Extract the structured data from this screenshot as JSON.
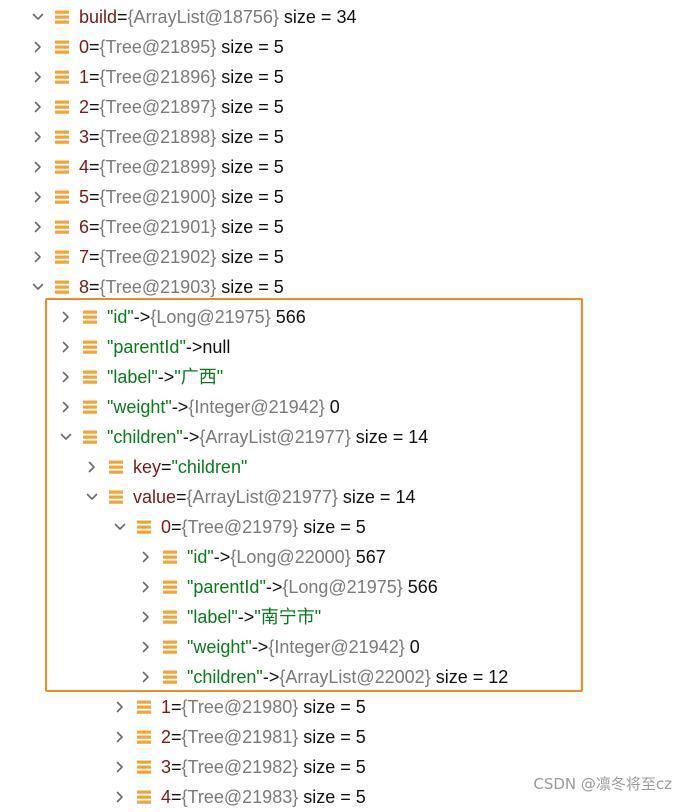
{
  "colors": {
    "icon_orange": "#f0a53b",
    "highlight": "#f08a24",
    "string_green": "#067d17",
    "key_red": "#7a1a1a",
    "ref_gray": "#7a7a7a"
  },
  "rows": [
    {
      "expanded": true,
      "icon": "list-icon",
      "name": "build",
      "op": " = ",
      "ref": "{ArrayList@18756}",
      "tail": " size = 34",
      "key_string": false,
      "value_string": false
    },
    {
      "expanded": false,
      "icon": "list-icon",
      "name": "0",
      "op": " = ",
      "ref": "{Tree@21895}",
      "tail": " size = 5",
      "key_string": false,
      "value_string": false
    },
    {
      "expanded": false,
      "icon": "list-icon",
      "name": "1",
      "op": " = ",
      "ref": "{Tree@21896}",
      "tail": " size = 5",
      "key_string": false,
      "value_string": false
    },
    {
      "expanded": false,
      "icon": "list-icon",
      "name": "2",
      "op": " = ",
      "ref": "{Tree@21897}",
      "tail": " size = 5",
      "key_string": false,
      "value_string": false
    },
    {
      "expanded": false,
      "icon": "list-icon",
      "name": "3",
      "op": " = ",
      "ref": "{Tree@21898}",
      "tail": " size = 5",
      "key_string": false,
      "value_string": false
    },
    {
      "expanded": false,
      "icon": "list-icon",
      "name": "4",
      "op": " = ",
      "ref": "{Tree@21899}",
      "tail": " size = 5",
      "key_string": false,
      "value_string": false
    },
    {
      "expanded": false,
      "icon": "list-icon",
      "name": "5",
      "op": " = ",
      "ref": "{Tree@21900}",
      "tail": " size = 5",
      "key_string": false,
      "value_string": false
    },
    {
      "expanded": false,
      "icon": "list-icon",
      "name": "6",
      "op": " = ",
      "ref": "{Tree@21901}",
      "tail": " size = 5",
      "key_string": false,
      "value_string": false
    },
    {
      "expanded": false,
      "icon": "list-icon",
      "name": "7",
      "op": " = ",
      "ref": "{Tree@21902}",
      "tail": " size = 5",
      "key_string": false,
      "value_string": false
    },
    {
      "expanded": true,
      "icon": "list-icon",
      "name": "8",
      "op": " = ",
      "ref": "{Tree@21903}",
      "tail": " size = 5",
      "key_string": false,
      "value_string": false
    },
    {
      "expanded": false,
      "icon": "list-icon",
      "name": "\"id\"",
      "op": " -> ",
      "ref": "{Long@21975}",
      "tail": " 566",
      "key_string": true,
      "value_string": false
    },
    {
      "expanded": false,
      "icon": "list-icon",
      "name": "\"parentId\"",
      "op": " -> ",
      "ref": "",
      "tail": "null",
      "key_string": true,
      "value_string": false
    },
    {
      "expanded": false,
      "icon": "list-icon",
      "name": "\"label\"",
      "op": " -> ",
      "ref": "",
      "tail": "\"广西\"",
      "key_string": true,
      "value_string": true
    },
    {
      "expanded": false,
      "icon": "list-icon",
      "name": "\"weight\"",
      "op": " -> ",
      "ref": "{Integer@21942}",
      "tail": " 0",
      "key_string": true,
      "value_string": false
    },
    {
      "expanded": true,
      "icon": "list-icon",
      "name": "\"children\"",
      "op": " -> ",
      "ref": "{ArrayList@21977}",
      "tail": " size = 14",
      "key_string": true,
      "value_string": false
    },
    {
      "expanded": false,
      "icon": "list-icon",
      "name": "key",
      "op": " = ",
      "ref": "",
      "tail": "\"children\"",
      "key_string": false,
      "value_string": true
    },
    {
      "expanded": true,
      "icon": "list-icon",
      "name": "value",
      "op": " = ",
      "ref": "{ArrayList@21977}",
      "tail": " size = 14",
      "key_string": false,
      "value_string": false
    },
    {
      "expanded": true,
      "icon": "list-icon",
      "name": "0",
      "op": " = ",
      "ref": "{Tree@21979}",
      "tail": " size = 5",
      "key_string": false,
      "value_string": false
    },
    {
      "expanded": false,
      "icon": "list-icon",
      "name": "\"id\"",
      "op": " -> ",
      "ref": "{Long@22000}",
      "tail": " 567",
      "key_string": true,
      "value_string": false
    },
    {
      "expanded": false,
      "icon": "list-icon",
      "name": "\"parentId\"",
      "op": " -> ",
      "ref": "{Long@21975}",
      "tail": " 566",
      "key_string": true,
      "value_string": false
    },
    {
      "expanded": false,
      "icon": "list-icon",
      "name": "\"label\"",
      "op": " -> ",
      "ref": "",
      "tail": "\"南宁市\"",
      "key_string": true,
      "value_string": true
    },
    {
      "expanded": false,
      "icon": "list-icon",
      "name": "\"weight\"",
      "op": " -> ",
      "ref": "{Integer@21942}",
      "tail": " 0",
      "key_string": true,
      "value_string": false
    },
    {
      "expanded": false,
      "icon": "list-icon",
      "name": "\"children\"",
      "op": " -> ",
      "ref": "{ArrayList@22002}",
      "tail": " size = 12",
      "key_string": true,
      "value_string": false
    },
    {
      "expanded": false,
      "icon": "list-icon",
      "name": "1",
      "op": " = ",
      "ref": "{Tree@21980}",
      "tail": " size = 5",
      "key_string": false,
      "value_string": false
    },
    {
      "expanded": false,
      "icon": "list-icon",
      "name": "2",
      "op": " = ",
      "ref": "{Tree@21981}",
      "tail": " size = 5",
      "key_string": false,
      "value_string": false
    },
    {
      "expanded": false,
      "icon": "list-icon",
      "name": "3",
      "op": " = ",
      "ref": "{Tree@21982}",
      "tail": " size = 5",
      "key_string": false,
      "value_string": false
    },
    {
      "expanded": false,
      "icon": "list-icon",
      "name": "4",
      "op": " = ",
      "ref": "{Tree@21983}",
      "tail": " size = 5",
      "key_string": false,
      "value_string": false
    }
  ],
  "watermark": "CSDN @凛冬将至cz"
}
